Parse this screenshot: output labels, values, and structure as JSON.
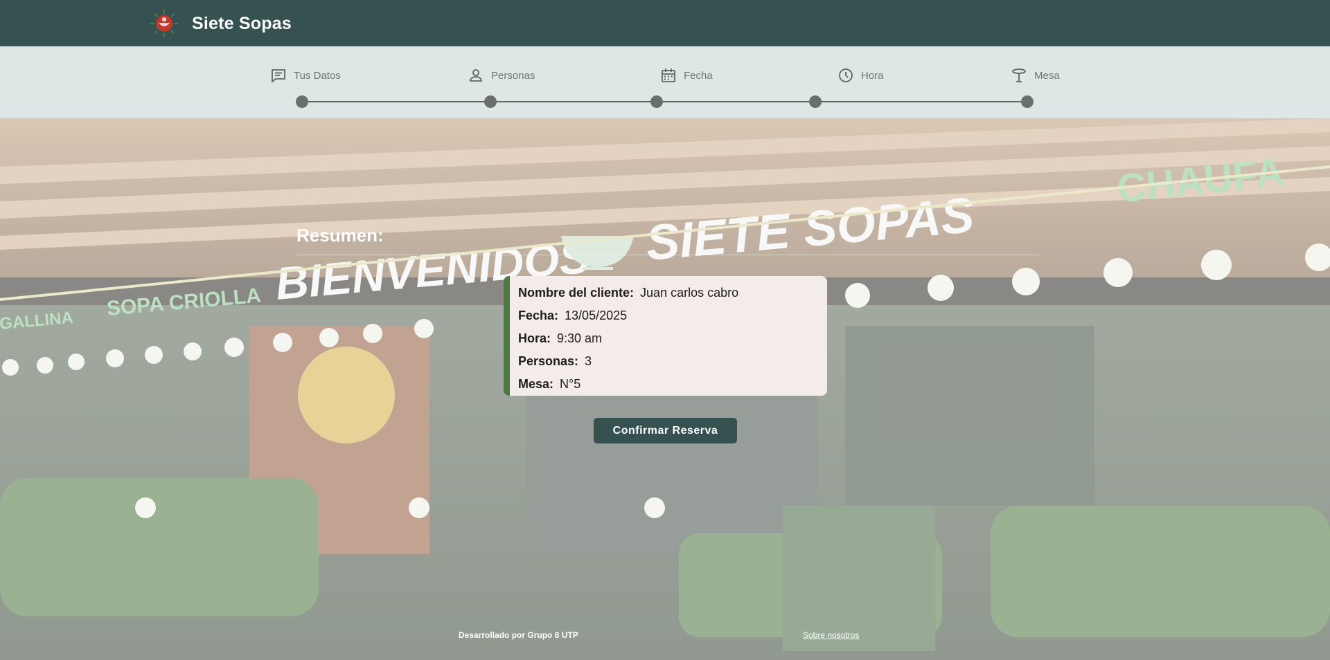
{
  "header": {
    "title": "Siete Sopas",
    "logo_icon": "bowl-logo-icon"
  },
  "stepper": {
    "steps": [
      {
        "label": "Tus Datos",
        "icon": "chat-icon"
      },
      {
        "label": "Personas",
        "icon": "person-icon"
      },
      {
        "label": "Fecha",
        "icon": "calendar-icon"
      },
      {
        "label": "Hora",
        "icon": "clock-icon"
      },
      {
        "label": "Mesa",
        "icon": "table-icon"
      }
    ]
  },
  "summary": {
    "title": "Resumen:",
    "rows": [
      {
        "label": "Nombre del cliente:",
        "value": "Juan carlos cabro"
      },
      {
        "label": "Fecha:",
        "value": "13/05/2025"
      },
      {
        "label": "Hora:",
        "value": "9:30 am"
      },
      {
        "label": "Personas:",
        "value": "3"
      },
      {
        "label": "Mesa:",
        "value": "N°5"
      }
    ]
  },
  "confirm_label": "Confirmar Reserva",
  "background": {
    "sign_left": "BIENVENIDOS",
    "sign_right": "SIETE SOPAS",
    "sign_chaufa": "CHAUFA",
    "sign_criolla": "SOPA CRIOLLA",
    "sign_gallina": "GALLINA"
  },
  "footer": {
    "credit": "Desarrollado por Grupo 8 UTP",
    "about_link": "Sobre nosotros"
  },
  "colors": {
    "header_bg": "#355150",
    "stepper_bg": "#dde7e5",
    "card_bg": "#f4ecea",
    "card_accent": "#4a7a3e",
    "button_bg": "#355150"
  }
}
